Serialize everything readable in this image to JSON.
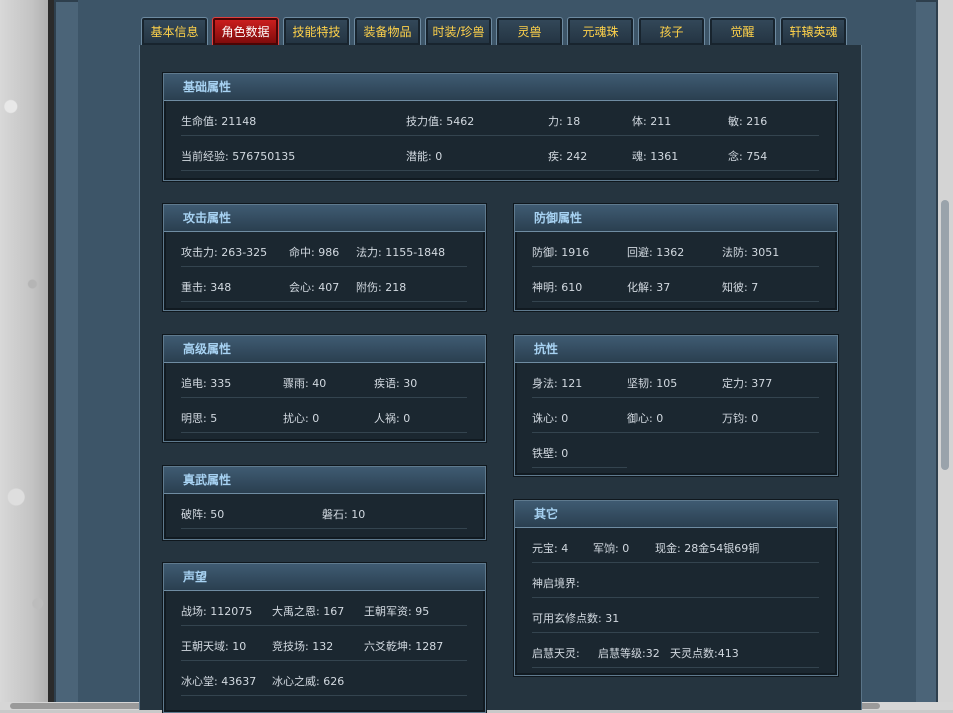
{
  "tabs": [
    "基本信息",
    "角色数据",
    "技能特技",
    "装备物品",
    "时装/珍兽",
    "灵兽",
    "元魂珠",
    "孩子",
    "觉醒",
    "轩辕英魂"
  ],
  "active_tab": "角色数据",
  "basic": {
    "title": "基础属性",
    "rows": [
      [
        "生命值: 21148",
        "技力值: 5462",
        "力: 18",
        "体: 211",
        "敏: 216"
      ],
      [
        "当前经验: 576750135",
        "潜能: 0",
        "疾: 242",
        "魂: 1361",
        "念: 754"
      ]
    ]
  },
  "attack": {
    "title": "攻击属性",
    "rows": [
      [
        "攻击力: 263-325",
        "命中: 986",
        "法力: 1155-1848"
      ],
      [
        "重击: 348",
        "会心: 407",
        "附伤: 218"
      ]
    ]
  },
  "defense": {
    "title": "防御属性",
    "rows": [
      [
        "防御: 1916",
        "回避: 1362",
        "法防: 3051"
      ],
      [
        "神明: 610",
        "化解: 37",
        "知彼: 7"
      ]
    ]
  },
  "advanced": {
    "title": "高级属性",
    "rows": [
      [
        "追电: 335",
        "骤雨: 40",
        "疾语: 30"
      ],
      [
        "明思: 5",
        "扰心: 0",
        "人祸: 0"
      ]
    ]
  },
  "resist": {
    "title": "抗性",
    "rows": [
      [
        "身法: 121",
        "坚韧: 105",
        "定力: 377"
      ],
      [
        "诛心: 0",
        "御心: 0",
        "万钧: 0"
      ],
      [
        "铁壁: 0"
      ]
    ]
  },
  "zhenwu": {
    "title": "真武属性",
    "rows": [
      [
        "破阵: 50",
        "磐石: 10"
      ]
    ]
  },
  "other": {
    "title": "其它",
    "rows": [
      [
        "元宝: 4",
        "军饷: 0",
        "现金: 28金54银69铜"
      ],
      [
        "神启境界:"
      ],
      [
        "可用玄修点数: 31"
      ],
      [
        "启慧天灵:",
        "启慧等级:32",
        "天灵点数:413"
      ]
    ]
  },
  "reputation": {
    "title": "声望",
    "rows": [
      [
        "战场: 112075",
        "大禹之恩: 167",
        "王朝军资: 95"
      ],
      [
        "王朝天域: 10",
        "竞技场: 132",
        "六爻乾坤: 1287"
      ],
      [
        "冰心堂: 43637",
        "冰心之威: 626"
      ]
    ]
  }
}
